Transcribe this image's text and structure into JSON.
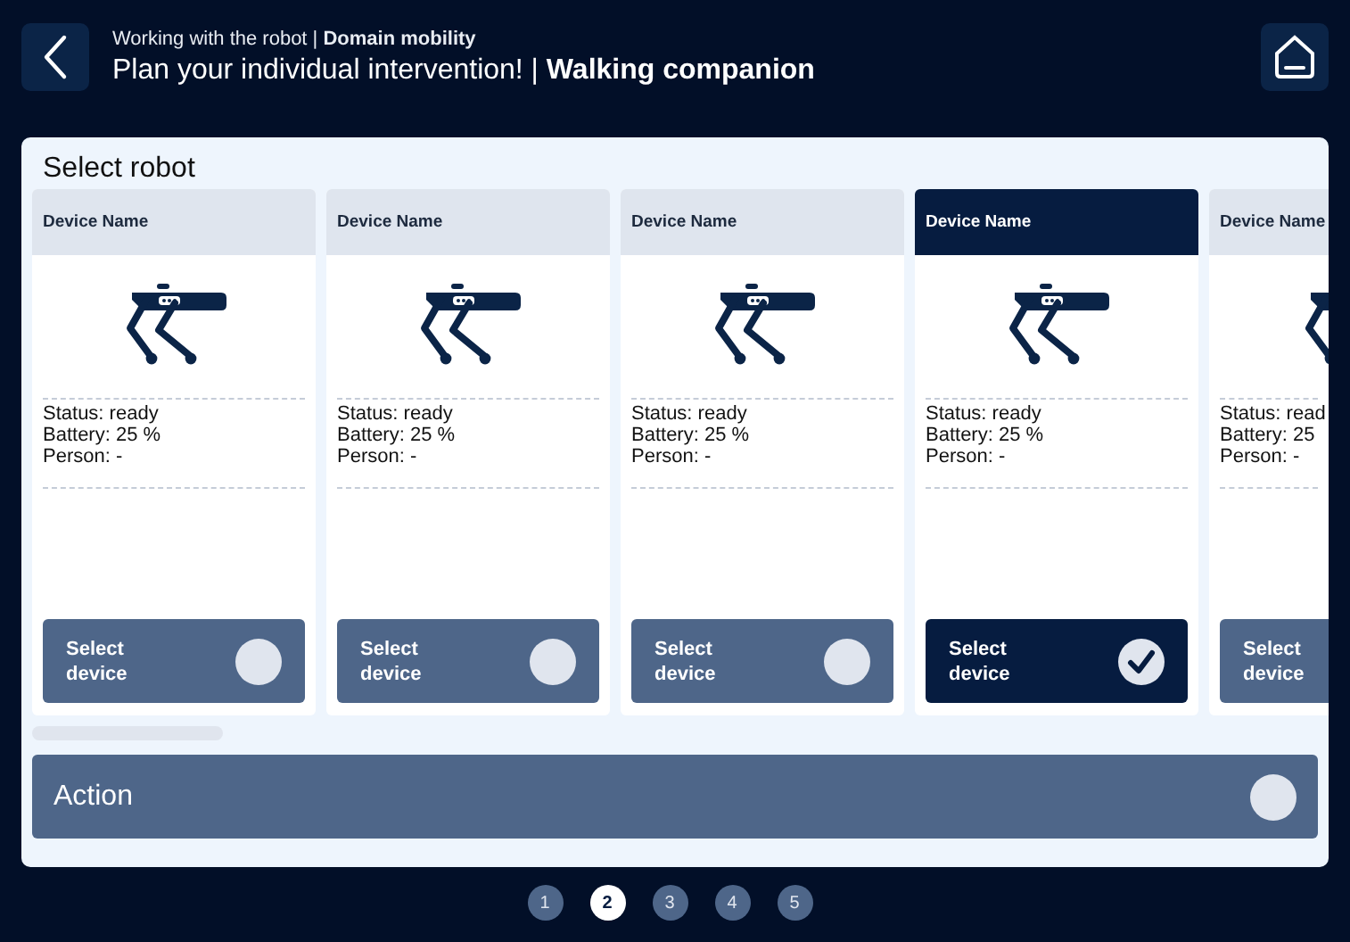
{
  "header": {
    "subtitle": "Working with the robot | **Domain mobility**",
    "title": "Plan your individual intervention! | **Walking companion**"
  },
  "panel": {
    "title": "Select robot"
  },
  "devices": [
    {
      "name": "Device Name",
      "status": "Status: ready",
      "battery": "Battery: 25 %",
      "person": "Person: -",
      "button": [
        "Select",
        "device"
      ],
      "selected": false,
      "cut": false
    },
    {
      "name": "Device Name",
      "status": "Status: ready",
      "battery": "Battery: 25 %",
      "person": "Person: -",
      "button": [
        "Select",
        "device"
      ],
      "selected": false,
      "cut": false
    },
    {
      "name": "Device Name",
      "status": "Status: ready",
      "battery": "Battery: 25 %",
      "person": "Person: -",
      "button": [
        "Select",
        "device"
      ],
      "selected": false,
      "cut": false
    },
    {
      "name": "Device Name",
      "status": "Status: ready",
      "battery": "Battery: 25 %",
      "person": "Person: -",
      "button": [
        "Select",
        "device"
      ],
      "selected": true,
      "cut": false
    },
    {
      "name": "Device Name",
      "status": "Status: read",
      "battery": "Battery: 25",
      "person": "Person: -",
      "button": [
        "Select",
        "device"
      ],
      "selected": false,
      "cut": true
    }
  ],
  "action": {
    "label": "Action",
    "checked": false
  },
  "pages": [
    {
      "label": "1",
      "selected": false
    },
    {
      "label": "2",
      "selected": true
    },
    {
      "label": "3",
      "selected": false
    },
    {
      "label": "4",
      "selected": false
    },
    {
      "label": "5",
      "selected": false
    }
  ]
}
